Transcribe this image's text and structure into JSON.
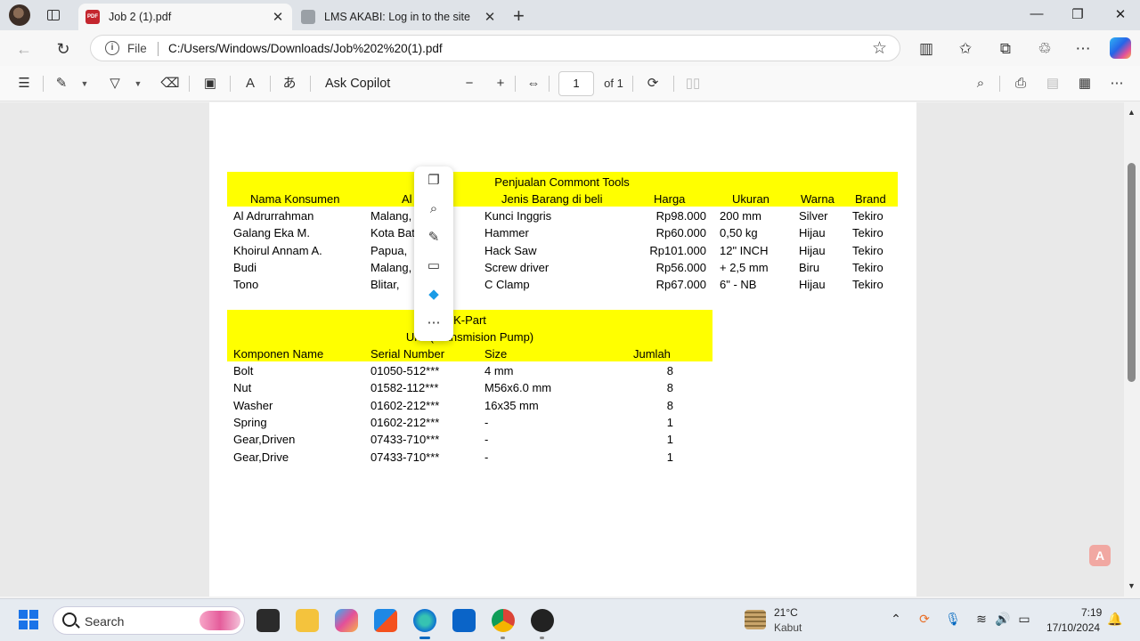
{
  "browser": {
    "tabs": [
      {
        "label": "Job 2 (1).pdf",
        "active": true,
        "favicon": "pdf-icon"
      },
      {
        "label": "LMS AKABI: Log in to the site",
        "active": false,
        "favicon": "site-icon"
      }
    ],
    "address": {
      "scheme_label": "File",
      "url": "C:/Users/Windows/Downloads/Job%202%20(1).pdf"
    }
  },
  "pdf_toolbar": {
    "ask_copilot": "Ask Copilot",
    "page_current": "1",
    "page_total": "of 1"
  },
  "document": {
    "table1": {
      "title": "Penjualan Commont Tools",
      "headers": [
        "Nama Konsumen",
        "Al",
        "Jenis Barang di beli",
        "Harga",
        "Ukuran",
        "Warna",
        "Brand"
      ],
      "rows": [
        [
          "Al Adrurrahman",
          "Malang,",
          "Kunci Inggris",
          "Rp98.000",
          "200 mm",
          "Silver",
          "Tekiro"
        ],
        [
          "Galang Eka M.",
          "Kota Batu,",
          "Hammer",
          "Rp60.000",
          "0,50 kg",
          "Hijau",
          "Tekiro"
        ],
        [
          "Khoirul Annam A.",
          "Papua,",
          "Hack Saw",
          "Rp101.000",
          "12\" INCH",
          "Hijau",
          "Tekiro"
        ],
        [
          "Budi",
          "Malang,",
          "Screw driver",
          "Rp56.000",
          "+  2,5 mm",
          "Biru",
          "Tekiro"
        ],
        [
          "Tono",
          "Blitar,",
          "C Clamp",
          "Rp67.000",
          "6\" - NB",
          "Hijau",
          "Tekiro"
        ]
      ]
    },
    "table2": {
      "title": "K-Part",
      "subtitle": "Unit (Transmision Pump)",
      "headers": [
        "Komponen Name",
        "Serial Number",
        "Size",
        "Jumlah"
      ],
      "rows": [
        [
          "Bolt",
          "01050-512***",
          "4 mm",
          "8"
        ],
        [
          "Nut",
          "01582-112***",
          "M56x6.0 mm",
          "8"
        ],
        [
          "Washer",
          "01602-212***",
          "16x35 mm",
          "8"
        ],
        [
          "Spring",
          "01602-212***",
          "-",
          "1"
        ],
        [
          "Gear,Driven",
          "07433-710***",
          "-",
          "1"
        ],
        [
          "Gear,Drive",
          "07433-710***",
          "-",
          "1"
        ]
      ]
    }
  },
  "taskbar": {
    "search_placeholder": "Search",
    "weather_temp": "21°C",
    "weather_desc": "Kabut",
    "time": "7:19",
    "date": "17/10/2024"
  },
  "colors": {
    "table_header_bg": "#ffff00",
    "accent": "#0067c0"
  }
}
